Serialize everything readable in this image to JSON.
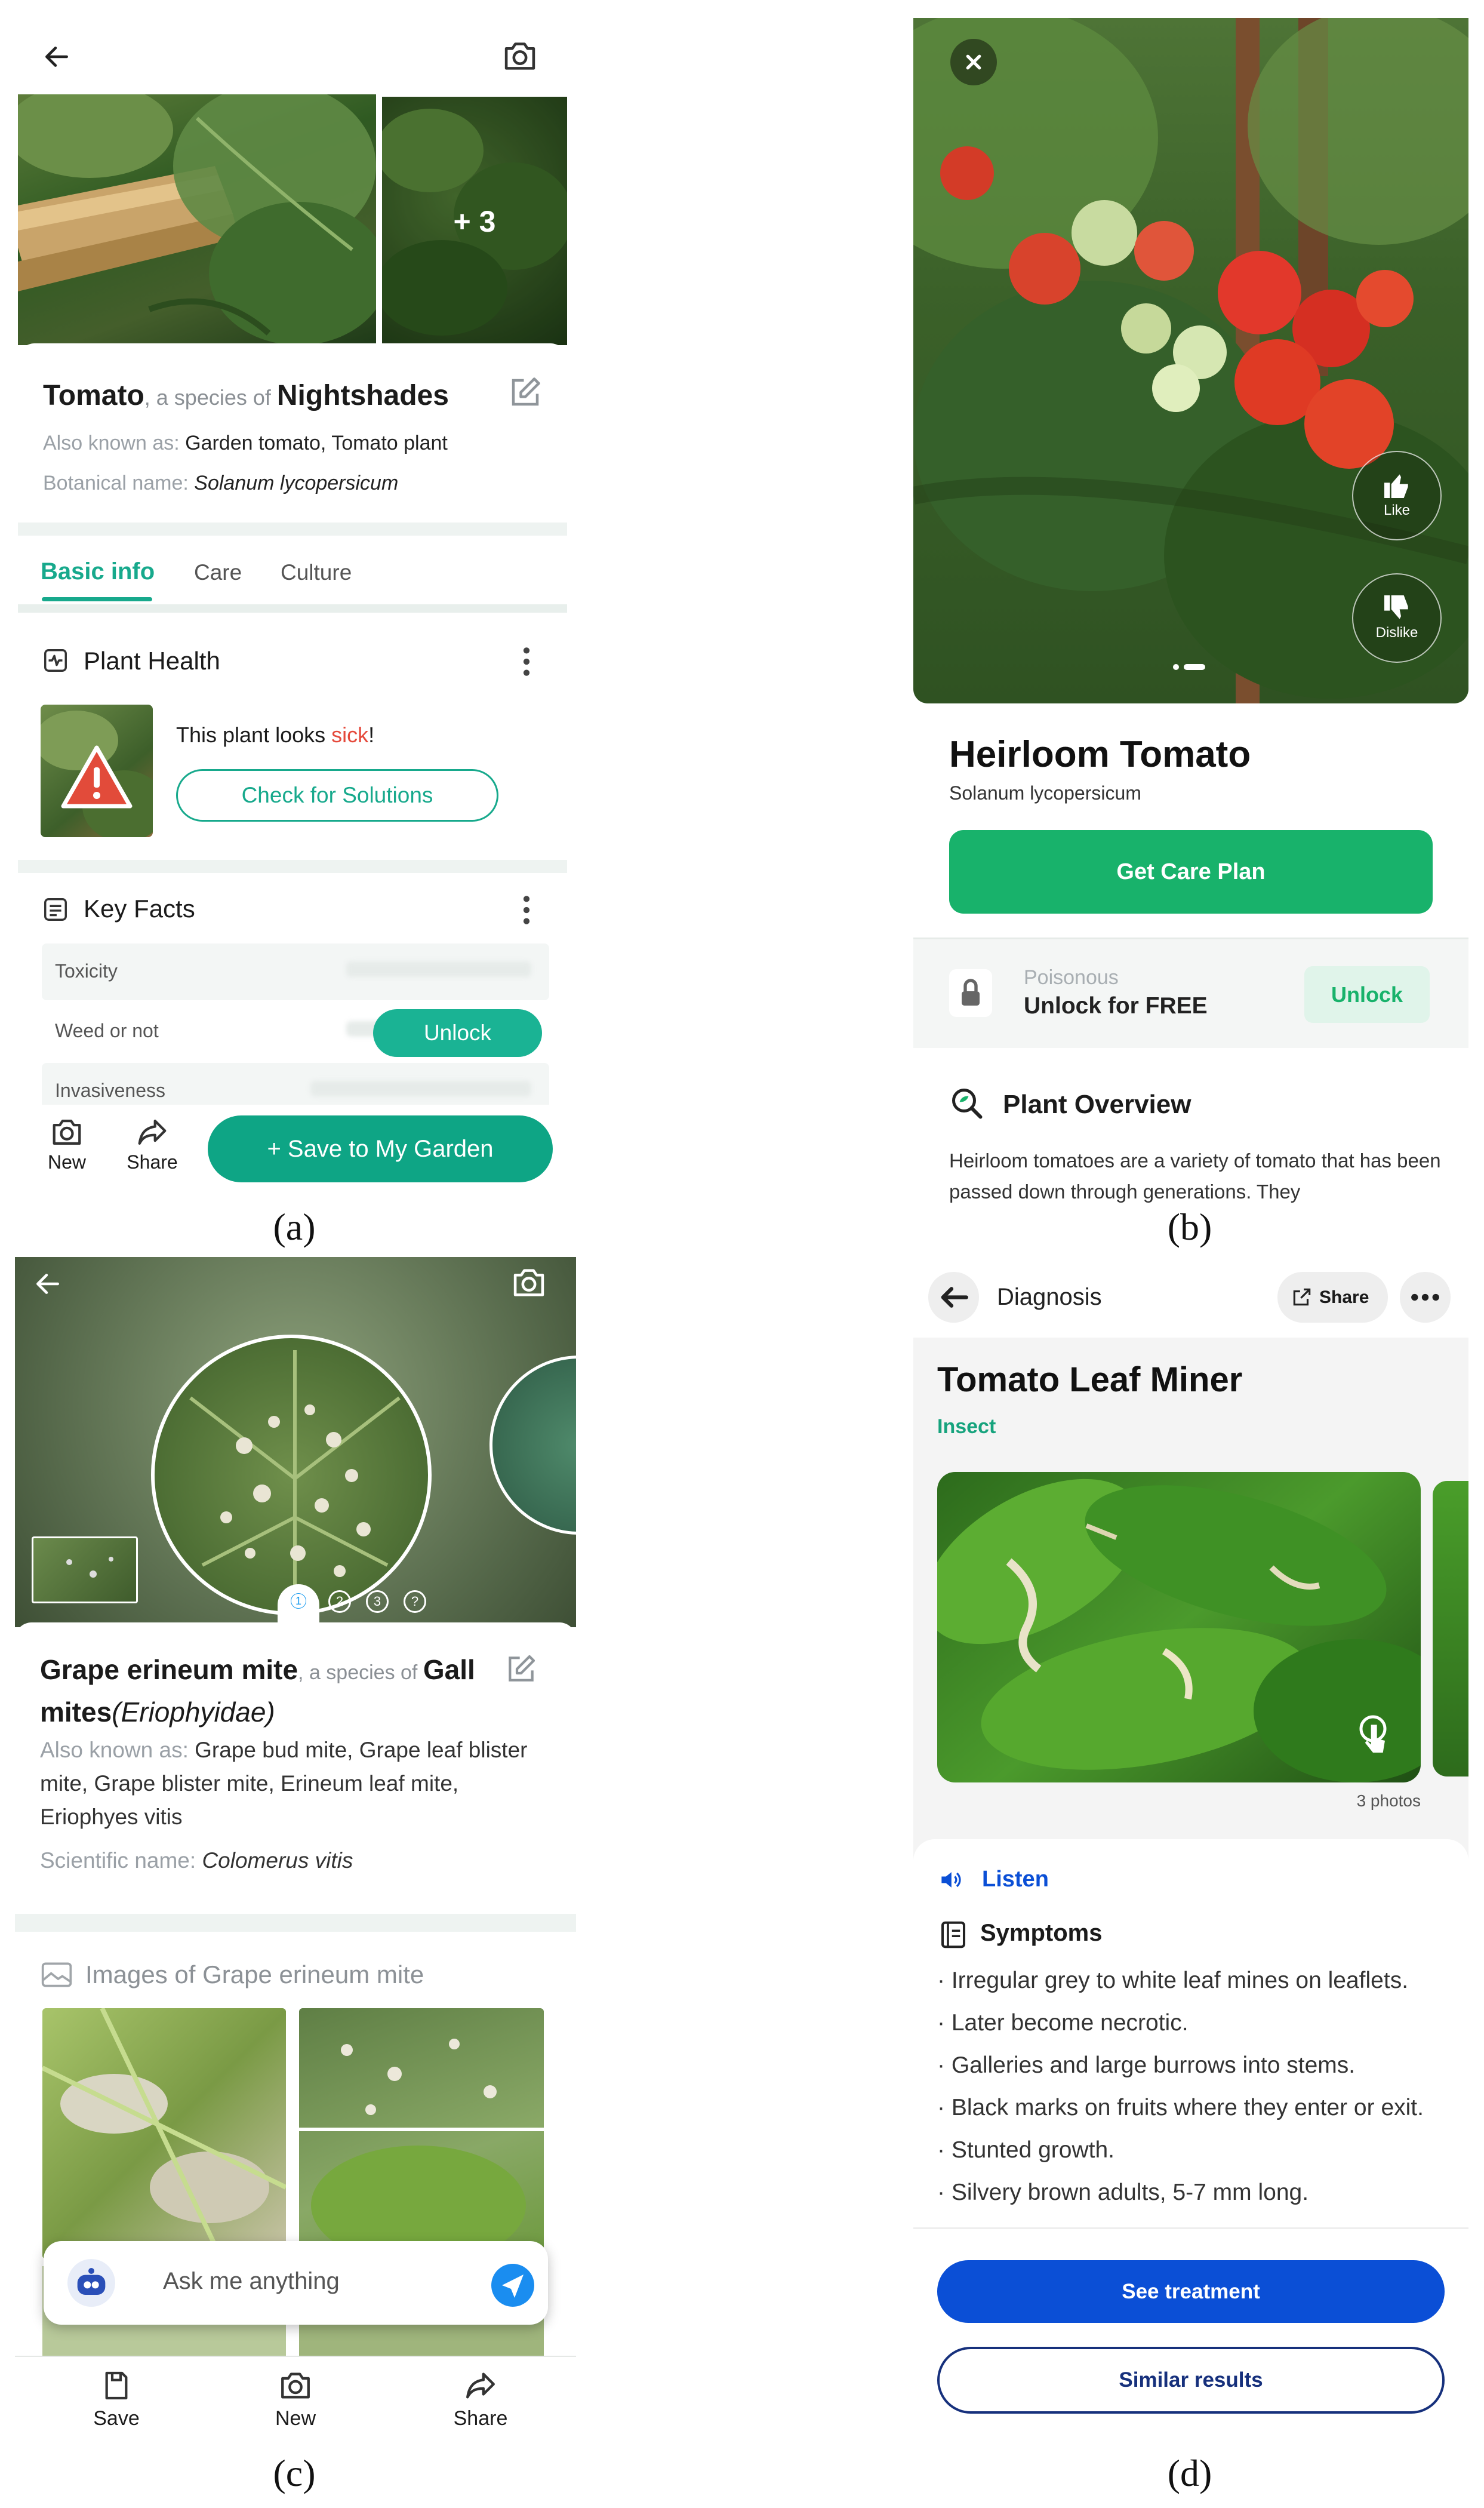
{
  "captions": {
    "a": "(a)",
    "b": "(b)",
    "c": "(c)",
    "d": "(d)"
  },
  "panel_a": {
    "photo_more": "+ 3",
    "name": "Tomato",
    "species_of": ", a species of ",
    "family": "Nightshades",
    "aka_label": "Also known as: ",
    "aka_value": "Garden tomato, Tomato plant",
    "botanical_label": "Botanical name: ",
    "botanical_value": "Solanum lycopersicum",
    "tabs": [
      "Basic info",
      "Care",
      "Culture"
    ],
    "health_title": "Plant Health",
    "sick_prefix": "This plant looks ",
    "sick_word": "sick",
    "sick_suffix": "!",
    "check_button": "Check for Solutions",
    "facts_title": "Key Facts",
    "facts": [
      "Toxicity",
      "Weed or not",
      "Invasiveness"
    ],
    "unlock": "Unlock",
    "nav_new": "New",
    "nav_share": "Share",
    "save_button": "+ Save to My Garden",
    "accent": "#17a98c"
  },
  "panel_b": {
    "like": "Like",
    "dislike": "Dislike",
    "title": "Heirloom Tomato",
    "subtitle": "Solanum lycopersicum",
    "care_button": "Get Care Plan",
    "poison_label": "Poisonous",
    "unlock_free": "Unlock for FREE",
    "unlock": "Unlock",
    "overview_title": "Plant Overview",
    "overview_text": "Heirloom tomatoes are a variety of tomato that has been passed down through generations. They",
    "accent": "#18b26b"
  },
  "panel_c": {
    "pages": [
      "1",
      "2",
      "3",
      "?"
    ],
    "name": "Grape erineum mite",
    "species_of": ", a species of ",
    "family": "Gall mites",
    "family_latin": "(Eriophyidae)",
    "aka_label": "Also known as: ",
    "aka_value": "Grape bud mite, Grape leaf blister mite, Grape blister mite, Erineum leaf mite, Eriophyes vitis",
    "sci_label": "Scientific name: ",
    "sci_value": "Colomerus vitis",
    "images_title": "Images of Grape erineum mite",
    "ask_placeholder": "Ask me anything",
    "nav": [
      "Save",
      "New",
      "Share"
    ]
  },
  "panel_d": {
    "header": "Diagnosis",
    "share": "Share",
    "title": "Tomato Leaf Miner",
    "category": "Insect",
    "photo_count": "3 photos",
    "listen": "Listen",
    "symptoms_title": "Symptoms",
    "symptoms": [
      "Irregular grey to white leaf mines on leaflets.",
      "Later become necrotic.",
      "Galleries and large burrows into stems.",
      "Black marks on fruits where they enter or exit.",
      "Stunted growth.",
      "Silvery brown adults, 5-7 mm long."
    ],
    "treatment_button": "See treatment",
    "similar_button": "Similar results",
    "accent": "#0b4fd6"
  }
}
